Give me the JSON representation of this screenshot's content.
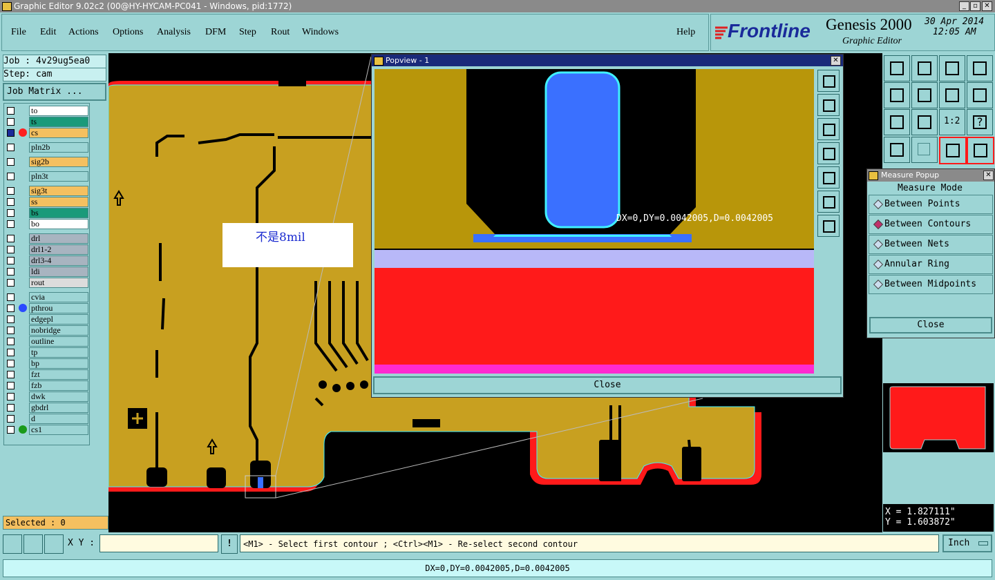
{
  "window": {
    "title": "Graphic Editor 9.02c2 (00@HY-HYCAM-PC041 - Windows, pid:1772)"
  },
  "menu": {
    "items": [
      "File",
      "Edit",
      "Actions",
      "Options",
      "Analysis",
      "DFM",
      "Step",
      "Rout",
      "Windows"
    ],
    "help": "Help"
  },
  "brand": {
    "logo": "Frontline",
    "product": "Genesis 2000",
    "subtitle": "Graphic Editor",
    "date": "30 Apr 2014",
    "time": "12:05 AM"
  },
  "job": {
    "job": "Job : 4v29ug5ea0",
    "step": "Step: cam",
    "matrix_button": "Job Matrix ..."
  },
  "layers": [
    {
      "name": "to",
      "bg": "#ffffff",
      "dot": ""
    },
    {
      "name": "ts",
      "bg": "#1a9a7a",
      "dot": ""
    },
    {
      "name": "cs",
      "bg": "#f5c060",
      "dot": "#ff2020",
      "active": true
    },
    {
      "name": "pln2b",
      "bg": "#9dd5d5",
      "dot": ""
    },
    {
      "name": "sig2b",
      "bg": "#f5c060",
      "dot": ""
    },
    {
      "name": "pln3t",
      "bg": "#9dd5d5",
      "dot": ""
    },
    {
      "name": "sig3t",
      "bg": "#f5c060",
      "dot": ""
    },
    {
      "name": "ss",
      "bg": "#f5c060",
      "dot": ""
    },
    {
      "name": "bs",
      "bg": "#1a9a7a",
      "dot": ""
    },
    {
      "name": "bo",
      "bg": "#ffffff",
      "dot": ""
    },
    {
      "name": "drl",
      "bg": "#a8b4c0",
      "dot": ""
    },
    {
      "name": "drl1-2",
      "bg": "#a8b4c0",
      "dot": ""
    },
    {
      "name": "drl3-4",
      "bg": "#a8b4c0",
      "dot": ""
    },
    {
      "name": "ldi",
      "bg": "#a8b4c0",
      "dot": ""
    },
    {
      "name": "rout",
      "bg": "#dcdcdc",
      "dot": ""
    },
    {
      "name": "cvia",
      "bg": "#9dd5d5",
      "dot": ""
    },
    {
      "name": "pthrou",
      "bg": "#9dd5d5",
      "dot": "#2a4aff"
    },
    {
      "name": "edgepl",
      "bg": "#9dd5d5",
      "dot": ""
    },
    {
      "name": "nobridge",
      "bg": "#9dd5d5",
      "dot": ""
    },
    {
      "name": "outline",
      "bg": "#9dd5d5",
      "dot": ""
    },
    {
      "name": "tp",
      "bg": "#9dd5d5",
      "dot": ""
    },
    {
      "name": "bp",
      "bg": "#9dd5d5",
      "dot": ""
    },
    {
      "name": "fzt",
      "bg": "#9dd5d5",
      "dot": ""
    },
    {
      "name": "fzb",
      "bg": "#9dd5d5",
      "dot": ""
    },
    {
      "name": "dwk",
      "bg": "#9dd5d5",
      "dot": ""
    },
    {
      "name": "gbdrl",
      "bg": "#9dd5d5",
      "dot": ""
    },
    {
      "name": "d",
      "bg": "#9dd5d5",
      "dot": ""
    },
    {
      "name": "cs1",
      "bg": "#9dd5d5",
      "dot": "#1a9a1a"
    }
  ],
  "selected": "Selected : 0",
  "annotation": "不是8mil",
  "popview": {
    "title": "Popview - 1",
    "measure_text": "DX=0,DY=0.0042005,D=0.0042005",
    "close": "Close"
  },
  "measure_popup": {
    "title": "Measure Popup",
    "header": "Measure Mode",
    "options": [
      "Between Points",
      "Between Contours",
      "Between Nets",
      "Annular Ring",
      "Between Midpoints"
    ],
    "selected_index": 1,
    "close": "Close"
  },
  "coords": {
    "x": "X = 1.827111\"",
    "y": "Y = 1.603872\""
  },
  "statusline": {
    "xy_label": "X Y :",
    "xy_value": "",
    "prompt": "<M1> - Select first contour ; <Ctrl><M1> - Re-select second contour",
    "units": "Inch"
  },
  "bottom_status": "DX=0,DY=0.0042005,D=0.0042005",
  "colors": {
    "copper": "#b8960a",
    "board": "#c8a020",
    "red": "#ff1a1a",
    "magenta": "#ff2ad0",
    "blue": "#3a70ff",
    "cyan": "#40f0ff",
    "laminate": "#b8b8f8",
    "panel": "#9dd5d5"
  }
}
